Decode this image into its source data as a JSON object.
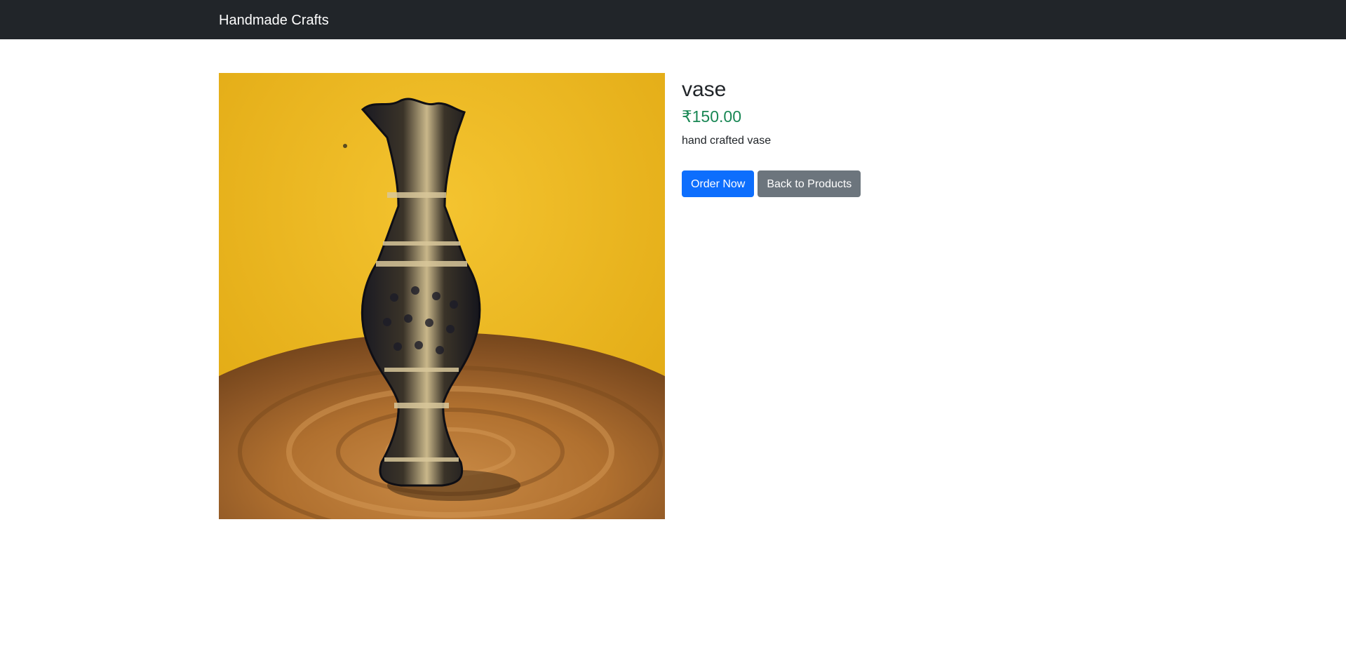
{
  "navbar": {
    "brand": "Handmade Crafts"
  },
  "product": {
    "name": "vase",
    "price": "₹150.00",
    "description": "hand crafted vase",
    "image_alt": "vase"
  },
  "actions": {
    "order_label": "Order Now",
    "back_label": "Back to Products"
  },
  "colors": {
    "navbar_bg": "#212529",
    "primary": "#0d6efd",
    "secondary": "#6c757d",
    "price": "#198754"
  }
}
